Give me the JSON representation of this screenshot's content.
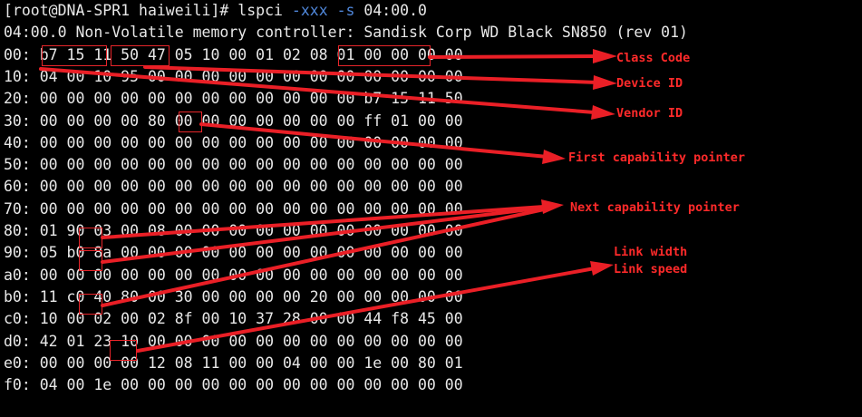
{
  "prompt": {
    "user_host": "[root@DNA-SPR1 haiweili]#",
    "command": "lspci",
    "opt1": "-xxx",
    "opt2": "-s",
    "arg": "04:00.0"
  },
  "device_line": "04:00.0 Non-Volatile memory controller: Sandisk Corp WD Black SN850 (rev 01)",
  "hex_rows": [
    "00: b7 15 11 50 47 05 10 00 01 02 08 01 00 00 00 00",
    "10: 04 00 10 95 00 00 00 00 00 00 00 00 00 00 00 00",
    "20: 00 00 00 00 00 00 00 00 00 00 00 00 b7 15 11 50",
    "30: 00 00 00 00 80 00 00 00 00 00 00 00 ff 01 00 00",
    "40: 00 00 00 00 00 00 00 00 00 00 00 00 00 00 00 00",
    "50: 00 00 00 00 00 00 00 00 00 00 00 00 00 00 00 00",
    "60: 00 00 00 00 00 00 00 00 00 00 00 00 00 00 00 00",
    "70: 00 00 00 00 00 00 00 00 00 00 00 00 00 00 00 00",
    "80: 01 90 03 00 08 00 00 00 00 00 00 00 00 00 00 00",
    "90: 05 b0 8a 00 00 00 00 00 00 00 00 00 00 00 00 00",
    "a0: 00 00 00 00 00 00 00 00 00 00 00 00 00 00 00 00",
    "b0: 11 c0 40 80 00 30 00 00 00 00 20 00 00 00 00 00",
    "c0: 10 00 02 00 02 8f 00 10 37 28 00 00 44 f8 45 00",
    "d0: 42 01 23 10 00 00 00 00 00 00 00 00 00 00 00 00",
    "e0: 00 00 00 00 12 08 11 00 00 04 00 00 1e 00 80 01",
    "f0: 04 00 1e 00 00 00 00 00 00 00 00 00 00 00 00 00"
  ],
  "annotations": {
    "class_code": "Class Code",
    "device_id": "Device ID",
    "vendor_id": "Vendor ID",
    "first_cap": "First capability pointer",
    "next_cap": "Next capability pointer",
    "link_width": "Link width",
    "link_speed": "Link speed"
  },
  "colors": {
    "annotation": "#ff2a2a",
    "option": "#4f86d9",
    "text": "#e8e8e8",
    "background": "#000000"
  }
}
